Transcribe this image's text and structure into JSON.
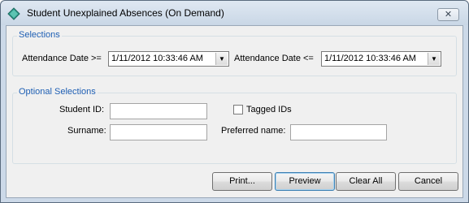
{
  "window": {
    "title": "Student Unexplained Absences (On Demand)",
    "close_glyph": "✕"
  },
  "selections": {
    "group_label": "Selections",
    "date_from_label": "Attendance Date >=",
    "date_from_value": "1/11/2012 10:33:46 AM",
    "date_to_label": "Attendance Date <=",
    "date_to_value": "1/11/2012 10:33:46 AM"
  },
  "optional": {
    "group_label": "Optional Selections",
    "student_id_label": "Student ID:",
    "student_id_value": "",
    "tagged_ids_label": "Tagged IDs",
    "tagged_ids_checked": false,
    "surname_label": "Surname:",
    "surname_value": "",
    "preferred_name_label": "Preferred name:",
    "preferred_name_value": ""
  },
  "buttons": {
    "print": "Print...",
    "preview": "Preview",
    "clear_all": "Clear All",
    "cancel": "Cancel"
  },
  "icons": {
    "app": "diamond-app-icon",
    "dropdown": "chevron-down-icon",
    "close": "close-icon"
  },
  "colors": {
    "group_label": "#1e5fb4",
    "titlebar": "#c9d7e6",
    "dialog_bg": "#f0f0f0"
  }
}
